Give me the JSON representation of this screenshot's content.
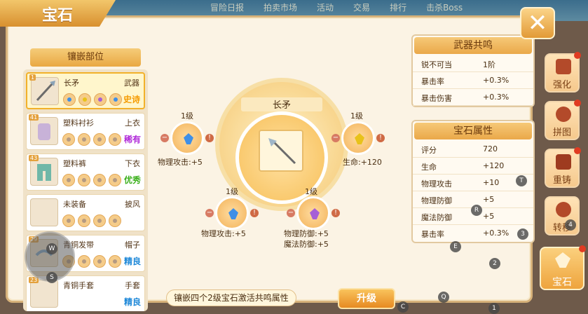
{
  "title": "宝石",
  "top_menu": [
    "冒险日报",
    "拍卖市场",
    "活动",
    "交易",
    "排行",
    "击杀Boss"
  ],
  "list_header": "镶嵌部位",
  "equipment": [
    {
      "level": "1",
      "name": "长矛",
      "type": "武器",
      "rarity": "史诗",
      "rarity_color": "#f59b00",
      "selected": true
    },
    {
      "level": "41",
      "name": "塑料衬衫",
      "type": "上衣",
      "rarity": "稀有",
      "rarity_color": "#b02ad8",
      "selected": false
    },
    {
      "level": "43",
      "name": "塑料裤",
      "type": "下衣",
      "rarity": "优秀",
      "rarity_color": "#3bb01c",
      "selected": false
    },
    {
      "level": "",
      "name": "未装备",
      "type": "披风",
      "rarity": "",
      "rarity_color": "#000000",
      "selected": false
    },
    {
      "level": "29",
      "name": "青铜发带",
      "type": "帽子",
      "rarity": "精良",
      "rarity_color": "#1e88d8",
      "selected": false
    },
    {
      "level": "23",
      "name": "青铜手套",
      "type": "手套",
      "rarity": "精良",
      "rarity_color": "#1e88d8",
      "selected": false
    }
  ],
  "center_item": "长矛",
  "gem_slots": [
    {
      "level": "1级",
      "attr": "物理攻击:+5",
      "color": "#3f8fe6"
    },
    {
      "level": "1级",
      "attr": "生命:+120",
      "color": "#e8c21a"
    },
    {
      "level": "1级",
      "attr": "物理攻击:+5",
      "color": "#3f8fe6"
    },
    {
      "level": "1级",
      "attr": "物理防御:+5",
      "attr2": "魔法防御:+5",
      "color": "#a65fd6"
    }
  ],
  "resonance": {
    "header": "武器共鸣",
    "rows": [
      {
        "k": "锐不可当",
        "v": "1阶"
      },
      {
        "k": "暴击率",
        "v": "+0.3%"
      },
      {
        "k": "暴击伤害",
        "v": "+0.3%"
      }
    ]
  },
  "gem_attrs": {
    "header": "宝石属性",
    "rows": [
      {
        "k": "评分",
        "v": "720"
      },
      {
        "k": "生命",
        "v": "+120"
      },
      {
        "k": "物理攻击",
        "v": "+10"
      },
      {
        "k": "物理防御",
        "v": "+5"
      },
      {
        "k": "魔法防御",
        "v": "+5"
      },
      {
        "k": "暴击率",
        "v": "+0.3%"
      }
    ]
  },
  "hint": "镶嵌四个2级宝石激活共鸣属性",
  "upgrade_button": "升级",
  "side_tabs": [
    {
      "label": "强化",
      "icon": "anvil-icon"
    },
    {
      "label": "拼图",
      "icon": "puzzle-icon"
    },
    {
      "label": "重铸",
      "icon": "hammer-icon"
    },
    {
      "label": "转移",
      "icon": "gear-icon"
    },
    {
      "label": "宝石",
      "icon": "gem-icon"
    }
  ],
  "keys": [
    "T",
    "R",
    "3",
    "E",
    "2",
    "C",
    "Q",
    "1",
    "4",
    "W",
    "S"
  ]
}
